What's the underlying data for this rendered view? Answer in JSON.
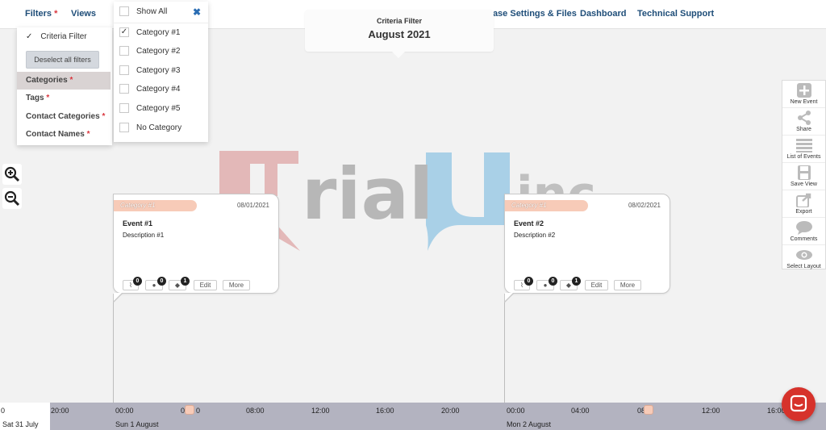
{
  "nav": {
    "filters": "Filters",
    "required_mark": "*",
    "views": "Views",
    "case_settings": "Case Settings & Files",
    "dashboard": "Dashboard",
    "technical_support": "Technical Support"
  },
  "criteria": {
    "label": "Criteria Filter",
    "period": "August 2021"
  },
  "filters_panel": {
    "criteria_filter": "Criteria Filter",
    "deselect_all": "Deselect all filters",
    "items": [
      {
        "label": "Categories",
        "active": true
      },
      {
        "label": "Tags",
        "active": false
      },
      {
        "label": "Contact Categories",
        "active": false
      },
      {
        "label": "Contact Names",
        "active": false
      }
    ]
  },
  "categories_panel": {
    "show_all": "Show All",
    "options": [
      {
        "label": "Category #1",
        "checked": true
      },
      {
        "label": "Category #2",
        "checked": false
      },
      {
        "label": "Category #3",
        "checked": false
      },
      {
        "label": "Category #4",
        "checked": false
      },
      {
        "label": "Category #5",
        "checked": false
      },
      {
        "label": "No Category",
        "checked": false
      }
    ]
  },
  "events": [
    {
      "category": "Category #1",
      "date": "08/01/2021",
      "title": "Event #1",
      "description": "Description #1",
      "attachments": "0",
      "comments": "0",
      "tags": "1",
      "edit": "Edit",
      "more": "More"
    },
    {
      "category": "Category #1",
      "date": "08/02/2021",
      "title": "Event #2",
      "description": "Description #2",
      "attachments": "0",
      "comments": "0",
      "tags": "1",
      "edit": "Edit",
      "more": "More"
    }
  ],
  "toolbar": {
    "new_event": "New Event",
    "share": "Share",
    "list_of_events": "List of Events",
    "save_view": "Save View",
    "export": "Export",
    "comments": "Comments",
    "select_layout": "Select Layout"
  },
  "timeline": {
    "ticks": [
      "0",
      "20:00",
      "00:00",
      "0",
      "0",
      "08:00",
      "12:00",
      "16:00",
      "20:00",
      "00:00",
      "04:00",
      "08",
      "0",
      "12:00",
      "16:00"
    ],
    "days": [
      "Sat 31 July",
      "Sun 1 August",
      "Mon 2 August"
    ]
  },
  "colors": {
    "accent": "#1e4d78",
    "category": "#f7cbb8",
    "chat": "#d6322b",
    "timeline": "#b3b3c0"
  }
}
